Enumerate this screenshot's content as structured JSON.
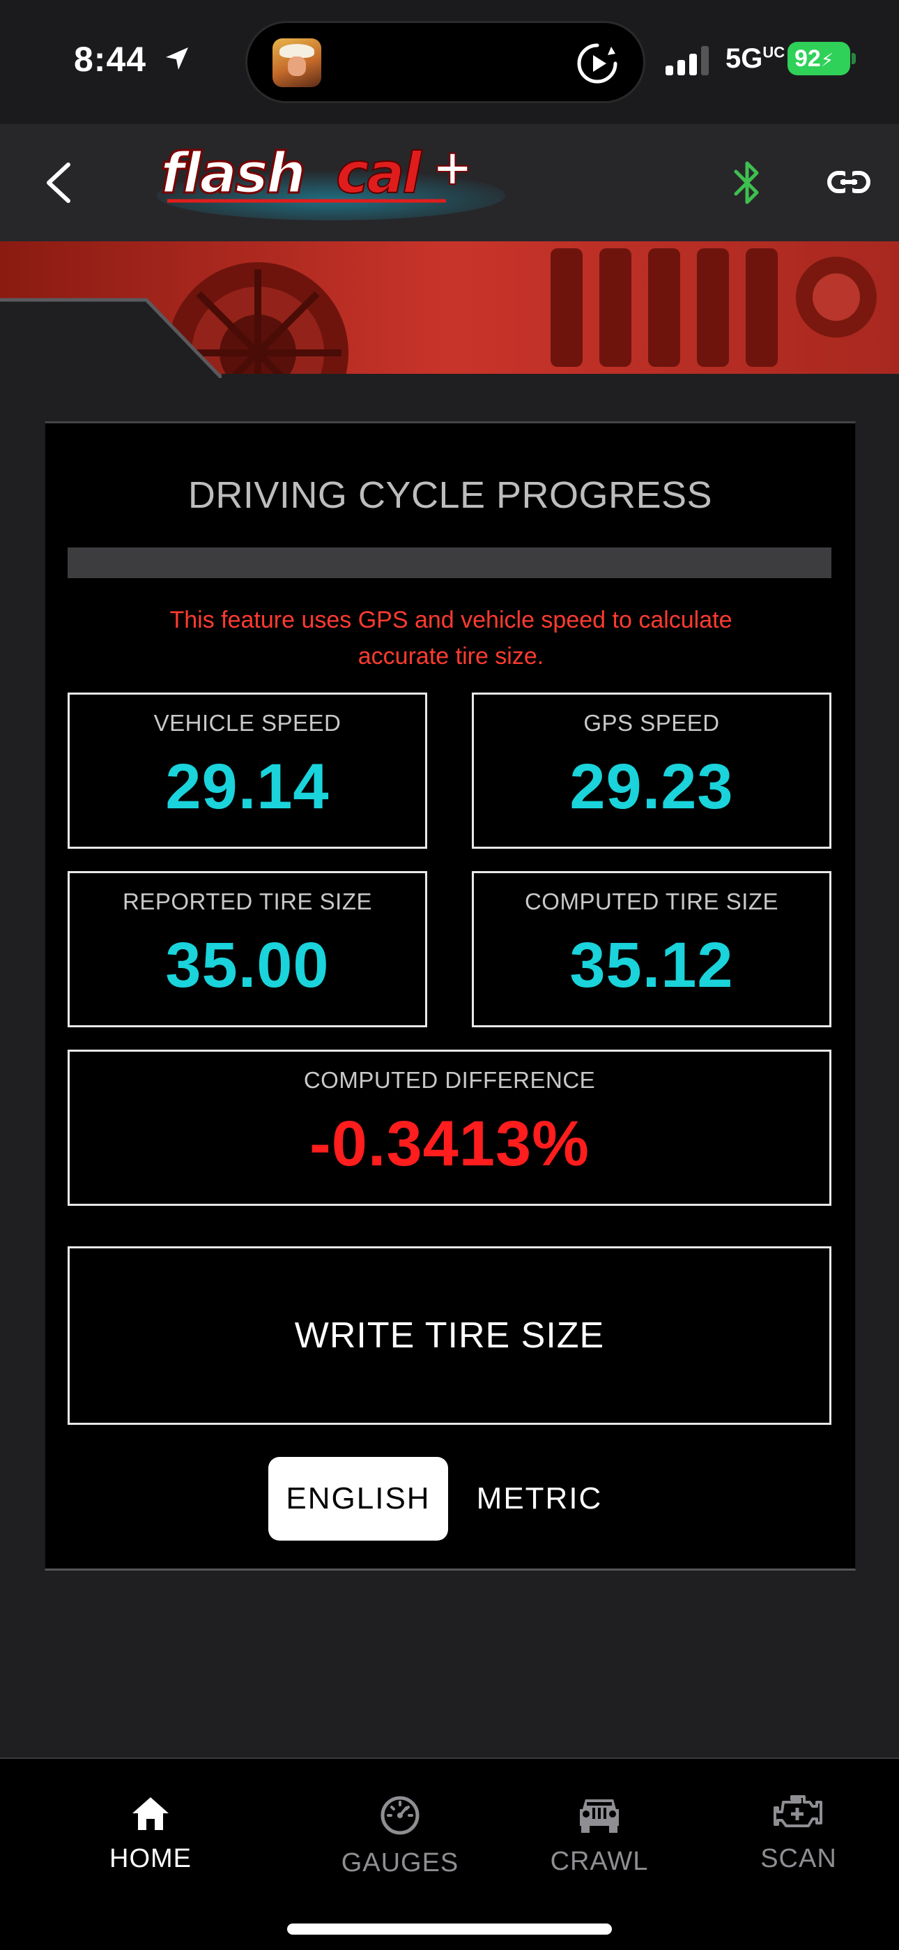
{
  "status_bar": {
    "time": "8:44",
    "network": "5G",
    "network_suffix": "UC",
    "battery": "92"
  },
  "header": {
    "logo_text": "flashcal+",
    "bluetooth_color": "#3fbf4f"
  },
  "card": {
    "title": "DRIVING CYCLE PROGRESS",
    "progress": 0,
    "notice": "This feature uses GPS and vehicle speed to calculate accurate tire size.",
    "stats": {
      "vehicle_speed": {
        "label": "VEHICLE SPEED",
        "value": "29.14"
      },
      "gps_speed": {
        "label": "GPS SPEED",
        "value": "29.23"
      },
      "reported_tire_size": {
        "label": "REPORTED TIRE SIZE",
        "value": "35.00"
      },
      "computed_tire_size": {
        "label": "COMPUTED TIRE SIZE",
        "value": "35.12"
      },
      "computed_difference": {
        "label": "COMPUTED DIFFERENCE",
        "value": "-0.3413%"
      }
    },
    "write_button": "WRITE TIRE SIZE",
    "units": {
      "english": "ENGLISH",
      "metric": "METRIC",
      "selected": "ENGLISH"
    }
  },
  "nav": {
    "home": "HOME",
    "gauges": "GAUGES",
    "crawl": "CRAWL",
    "scan": "SCAN",
    "active": "HOME"
  },
  "colors": {
    "accent_cyan": "#1ad3db",
    "warning_red": "#ff3b30",
    "difference_red": "#ff1d1d"
  }
}
